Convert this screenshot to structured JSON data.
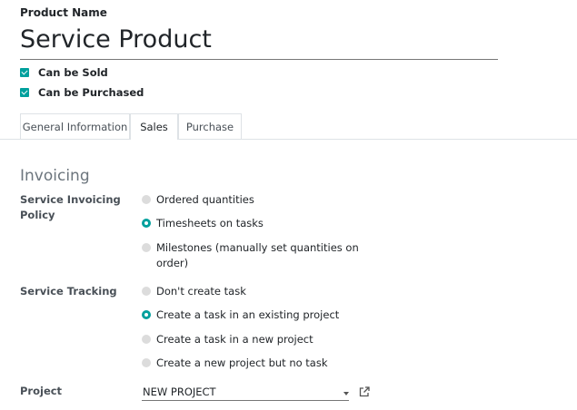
{
  "form": {
    "product_name_label": "Product Name",
    "product_name_value": "Service Product",
    "can_be_sold_label": "Can be Sold",
    "can_be_sold_checked": true,
    "can_be_purchased_label": "Can be Purchased",
    "can_be_purchased_checked": true
  },
  "tabs": [
    {
      "label": "General Information",
      "active": false
    },
    {
      "label": "Sales",
      "active": true
    },
    {
      "label": "Purchase",
      "active": false
    }
  ],
  "invoicing": {
    "section_title": "Invoicing",
    "policy_label_line1": "Service Invoicing",
    "policy_label_line2": "Policy",
    "policy_options": [
      {
        "label": "Ordered quantities",
        "selected": false
      },
      {
        "label": "Timesheets on tasks",
        "selected": true
      },
      {
        "label_line1": "Milestones (manually set quantities on",
        "label_line2": "order)",
        "selected": false
      }
    ],
    "tracking_label": "Service Tracking",
    "tracking_options": [
      {
        "label": "Don't create task",
        "selected": false
      },
      {
        "label": "Create a task in an existing project",
        "selected": true
      },
      {
        "label": "Create a task in a new project",
        "selected": false
      },
      {
        "label": "Create a new project but no task",
        "selected": false
      }
    ],
    "project_label": "Project",
    "project_value": "NEW PROJECT"
  },
  "colors": {
    "accent": "#00a09d",
    "radio_off": "#dcdcdc",
    "muted_title": "#6c757d"
  },
  "icons": [
    "checkbox-checked-icon",
    "radio-icon",
    "dropdown-caret-icon",
    "external-link-icon"
  ]
}
